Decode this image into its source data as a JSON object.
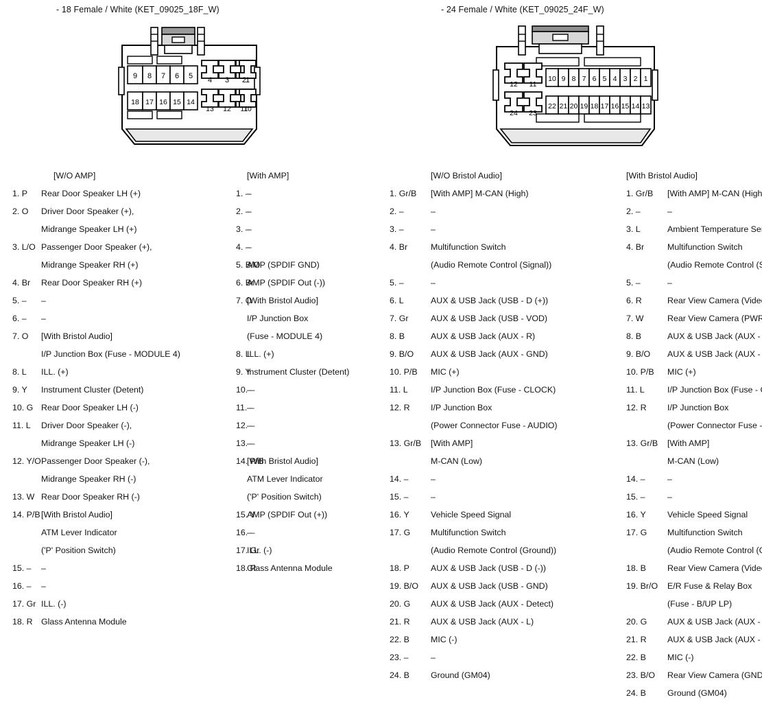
{
  "connectors": [
    {
      "title": "- 18 Female / White (KET_09025_18F_W)",
      "part": "KET_09025_18F_W",
      "pin_count": 18,
      "top_row": [
        "9",
        "8",
        "7",
        "6",
        "5",
        "4",
        "3",
        "2",
        "1"
      ],
      "bottom_row": [
        "18",
        "17",
        "16",
        "15",
        "14",
        "13",
        "12",
        "11",
        "10"
      ]
    },
    {
      "title": "- 24 Female / White (KET_09025_24F_W)",
      "part": "KET_09025_24F_W",
      "pin_count": 24,
      "top_row": [
        "12",
        "11",
        "10",
        "9",
        "8",
        "7",
        "6",
        "5",
        "4",
        "3",
        "2",
        "1"
      ],
      "bottom_row": [
        "24",
        "23",
        "22",
        "21",
        "20",
        "19",
        "18",
        "17",
        "16",
        "15",
        "14",
        "13"
      ]
    }
  ],
  "columns": [
    {
      "id": "col1",
      "header": "[W/O AMP]",
      "rows": [
        {
          "pin": "1. P",
          "desc": "Rear Door Speaker LH (+)"
        },
        {
          "pin": "2. O",
          "desc": "Driver Door Speaker (+),"
        },
        {
          "pin": "",
          "desc": "Midrange Speaker LH (+)"
        },
        {
          "pin": "3. L/O",
          "desc": "Passenger Door Speaker (+),"
        },
        {
          "pin": "",
          "desc": "Midrange Speaker RH (+)"
        },
        {
          "pin": "4. Br",
          "desc": "Rear Door Speaker RH (+)"
        },
        {
          "pin": "5. –",
          "desc": "–"
        },
        {
          "pin": "6. –",
          "desc": "–"
        },
        {
          "pin": "7. O",
          "desc": "[With Bristol Audio]"
        },
        {
          "pin": "",
          "desc": "I/P Junction Box (Fuse - MODULE 4)"
        },
        {
          "pin": "8. L",
          "desc": "ILL. (+)"
        },
        {
          "pin": "9. Y",
          "desc": "Instrument Cluster (Detent)"
        },
        {
          "pin": "10. G",
          "desc": "Rear Door Speaker LH (-)"
        },
        {
          "pin": "11. L",
          "desc": "Driver Door Speaker (-),"
        },
        {
          "pin": "",
          "desc": "Midrange Speaker LH (-)"
        },
        {
          "pin": "12. Y/O",
          "desc": "Passenger Door Speaker (-),"
        },
        {
          "pin": "",
          "desc": "Midrange Speaker RH (-)"
        },
        {
          "pin": "13. W",
          "desc": "Rear Door Speaker RH (-)"
        },
        {
          "pin": "14. P/B",
          "desc": "[With Bristol Audio]"
        },
        {
          "pin": "",
          "desc": "ATM Lever Indicator"
        },
        {
          "pin": "",
          "desc": "('P' Position Switch)"
        },
        {
          "pin": "15. –",
          "desc": "–"
        },
        {
          "pin": "16. –",
          "desc": "–"
        },
        {
          "pin": "17. Gr",
          "desc": "ILL. (-)"
        },
        {
          "pin": "18. R",
          "desc": "Glass Antenna Module"
        }
      ]
    },
    {
      "id": "col2",
      "header": "[With AMP]",
      "rows": [
        {
          "pin": "1. –",
          "desc": "–"
        },
        {
          "pin": "2. –",
          "desc": "–"
        },
        {
          "pin": "3. –",
          "desc": "–"
        },
        {
          "pin": "4. –",
          "desc": "–"
        },
        {
          "pin": "5. B/O",
          "desc": "AMP (SPDIF GND)"
        },
        {
          "pin": "6. Br",
          "desc": "AMP (SPDIF Out (-))"
        },
        {
          "pin": "7. O",
          "desc": "[With Bristol Audio]"
        },
        {
          "pin": "",
          "desc": "I/P Junction Box"
        },
        {
          "pin": "",
          "desc": "(Fuse - MODULE 4)"
        },
        {
          "pin": "8. L",
          "desc": "ILL. (+)"
        },
        {
          "pin": "9. Y",
          "desc": "Instrument Cluster (Detent)"
        },
        {
          "pin": "10. –",
          "desc": "–"
        },
        {
          "pin": "11. –",
          "desc": "–"
        },
        {
          "pin": "12. –",
          "desc": "–"
        },
        {
          "pin": "13. –",
          "desc": "–"
        },
        {
          "pin": "14. P/B",
          "desc": "[With Bristol Audio]"
        },
        {
          "pin": "",
          "desc": "ATM Lever Indicator"
        },
        {
          "pin": "",
          "desc": "('P' Position Switch)"
        },
        {
          "pin": "15. Y",
          "desc": "AMP (SPDIF Out (+))"
        },
        {
          "pin": "16. –",
          "desc": "–"
        },
        {
          "pin": "17. Gr",
          "desc": "ILL. (-)"
        },
        {
          "pin": "18. R",
          "desc": "Glass Antenna Module"
        }
      ]
    },
    {
      "id": "col3",
      "header": "[W/O Bristol Audio]",
      "rows": [
        {
          "pin": "1. Gr/B",
          "desc": "[With AMP] M-CAN (High)"
        },
        {
          "pin": "2. –",
          "desc": "–"
        },
        {
          "pin": "3. –",
          "desc": "–"
        },
        {
          "pin": "4. Br",
          "desc": "Multifunction Switch"
        },
        {
          "pin": "",
          "desc": "(Audio Remote Control (Signal))"
        },
        {
          "pin": "5. –",
          "desc": "–"
        },
        {
          "pin": "6. L",
          "desc": "AUX & USB Jack (USB - D (+))"
        },
        {
          "pin": "7. Gr",
          "desc": "AUX & USB Jack (USB - VOD)"
        },
        {
          "pin": "8. B",
          "desc": "AUX & USB Jack (AUX - R)"
        },
        {
          "pin": "9. B/O",
          "desc": "AUX & USB Jack (AUX - GND)"
        },
        {
          "pin": "10. P/B",
          "desc": "MIC (+)"
        },
        {
          "pin": "11. L",
          "desc": "I/P Junction Box (Fuse - CLOCK)"
        },
        {
          "pin": "12. R",
          "desc": "I/P Junction Box"
        },
        {
          "pin": "",
          "desc": "(Power Connector Fuse - AUDIO)"
        },
        {
          "pin": "13. Gr/B",
          "desc": "[With AMP]"
        },
        {
          "pin": "",
          "desc": "M-CAN (Low)"
        },
        {
          "pin": "14. –",
          "desc": "–"
        },
        {
          "pin": "15. –",
          "desc": "–"
        },
        {
          "pin": "16. Y",
          "desc": "Vehicle Speed Signal"
        },
        {
          "pin": "17. G",
          "desc": "Multifunction Switch"
        },
        {
          "pin": "",
          "desc": "(Audio Remote Control (Ground))"
        },
        {
          "pin": "18. P",
          "desc": "AUX & USB Jack (USB - D (-))"
        },
        {
          "pin": "19. B/O",
          "desc": "AUX & USB Jack (USB - GND)"
        },
        {
          "pin": "20. G",
          "desc": "AUX & USB Jack (AUX - Detect)"
        },
        {
          "pin": "21. R",
          "desc": "AUX & USB Jack (AUX - L)"
        },
        {
          "pin": "22. B",
          "desc": "MIC (-)"
        },
        {
          "pin": "23. –",
          "desc": "–"
        },
        {
          "pin": "24. B",
          "desc": "Ground (GM04)"
        }
      ]
    },
    {
      "id": "col4",
      "header": "[With Bristol Audio]",
      "rows": [
        {
          "pin": "1. Gr/B",
          "desc": "[With AMP] M-CAN (High)"
        },
        {
          "pin": "2. –",
          "desc": "–"
        },
        {
          "pin": "3. L",
          "desc": "Ambient Temperature Sensor"
        },
        {
          "pin": "4. Br",
          "desc": "Multifunction Switch"
        },
        {
          "pin": "",
          "desc": "(Audio Remote Control (Signal))"
        },
        {
          "pin": "5. –",
          "desc": "–"
        },
        {
          "pin": "6. R",
          "desc": "Rear View Camera (Video (+))"
        },
        {
          "pin": "7. W",
          "desc": "Rear View Camera (PWR)"
        },
        {
          "pin": "8. B",
          "desc": "AUX & USB Jack (AUX - R)"
        },
        {
          "pin": "9. B/O",
          "desc": "AUX & USB Jack (AUX - GND)"
        },
        {
          "pin": "10. P/B",
          "desc": "MIC (+)"
        },
        {
          "pin": "11. L",
          "desc": "I/P Junction Box (Fuse - CLOCK)"
        },
        {
          "pin": "12. R",
          "desc": "I/P Junction Box"
        },
        {
          "pin": "",
          "desc": "(Power Connector Fuse - AUDIO)"
        },
        {
          "pin": "13. Gr/B",
          "desc": "[With AMP]"
        },
        {
          "pin": "",
          "desc": "M-CAN (Low)"
        },
        {
          "pin": "14. –",
          "desc": "–"
        },
        {
          "pin": "15. –",
          "desc": "–"
        },
        {
          "pin": "16. Y",
          "desc": "Vehicle Speed Signal"
        },
        {
          "pin": "17. G",
          "desc": "Multifunction Switch"
        },
        {
          "pin": "",
          "desc": "(Audio Remote Control (Ground))"
        },
        {
          "pin": "18. B",
          "desc": "Rear View Camera (Video (-))"
        },
        {
          "pin": "19. Br/O",
          "desc": "E/R Fuse & Relay Box"
        },
        {
          "pin": "",
          "desc": "(Fuse - B/UP LP)"
        },
        {
          "pin": "20. G",
          "desc": "AUX & USB Jack (AUX - Detect)"
        },
        {
          "pin": "21. R",
          "desc": "AUX & USB Jack (AUX - L)"
        },
        {
          "pin": "22. B",
          "desc": "MIC (-)"
        },
        {
          "pin": "23. B/O",
          "desc": "Rear View Camera (GND)"
        },
        {
          "pin": "24. B",
          "desc": "Ground (GM04)"
        }
      ]
    }
  ],
  "colors": {
    "outline": "#000000",
    "fill": "#ffffff",
    "shade": "#cfcfcf",
    "text": "#131313"
  }
}
